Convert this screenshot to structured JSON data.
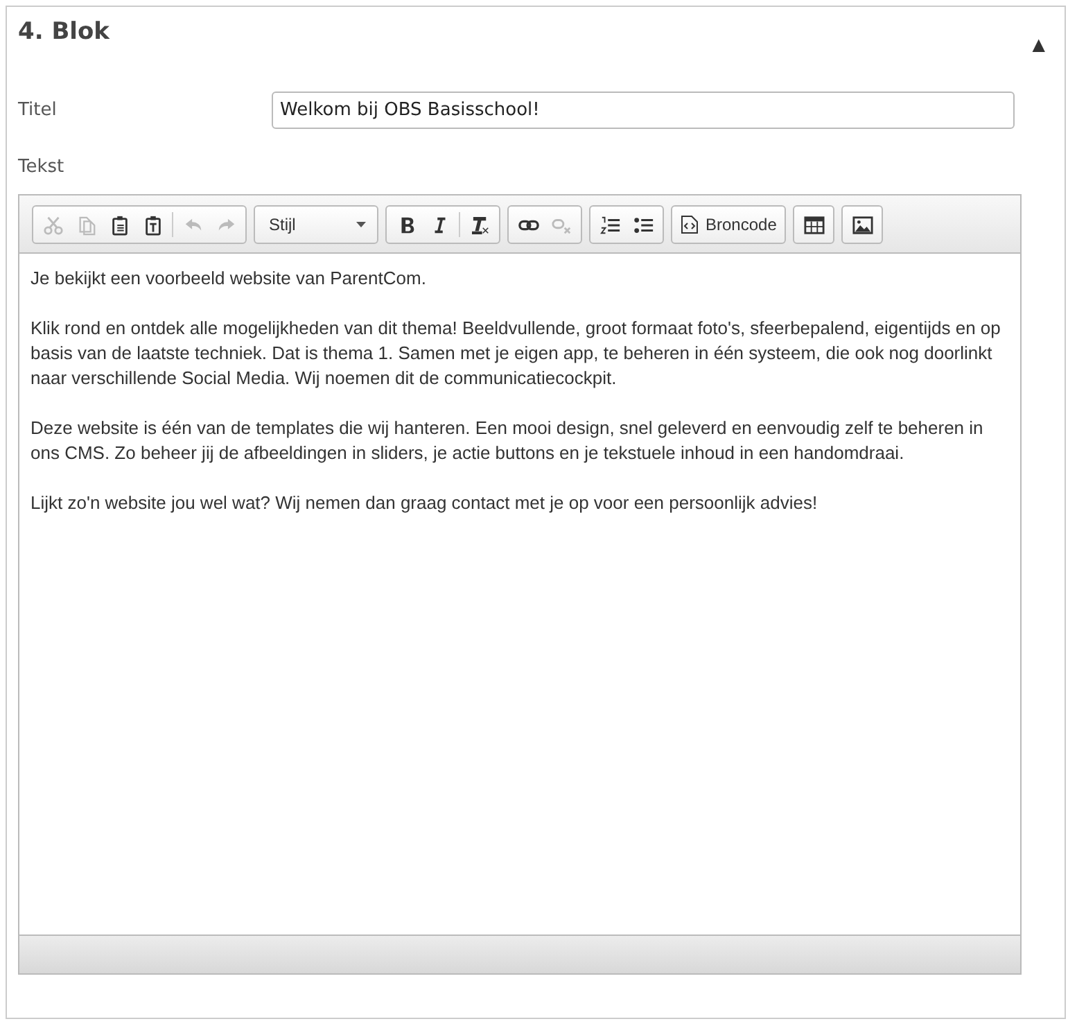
{
  "panel": {
    "title": "4. Blok",
    "collapse_glyph": "▲"
  },
  "fields": [
    {
      "label": "Titel",
      "value": "Welkom bij OBS Basisschool!"
    }
  ],
  "editor": {
    "label": "Tekst",
    "toolbar": [
      {
        "kind": "group",
        "buttons": [
          {
            "kind": "cut",
            "disabled": true
          },
          {
            "kind": "copy",
            "disabled": true
          },
          {
            "kind": "paste",
            "disabled": false
          },
          {
            "kind": "paste-text",
            "disabled": false
          },
          {
            "kind": "separator"
          },
          {
            "kind": "undo",
            "disabled": true
          },
          {
            "kind": "redo",
            "disabled": true
          }
        ]
      },
      {
        "kind": "dropdown",
        "label": "Stijl"
      },
      {
        "kind": "group",
        "buttons": [
          {
            "kind": "bold",
            "disabled": false
          },
          {
            "kind": "italic",
            "disabled": false
          },
          {
            "kind": "separator"
          },
          {
            "kind": "remove-format",
            "disabled": false
          }
        ]
      },
      {
        "kind": "group",
        "buttons": [
          {
            "kind": "link",
            "disabled": false
          },
          {
            "kind": "unlink",
            "disabled": true
          }
        ]
      },
      {
        "kind": "group",
        "buttons": [
          {
            "kind": "numbered-list",
            "disabled": false
          },
          {
            "kind": "bulleted-list",
            "disabled": false
          }
        ]
      },
      {
        "kind": "source",
        "label": "Broncode"
      },
      {
        "kind": "group",
        "buttons": [
          {
            "kind": "table",
            "disabled": false
          }
        ]
      },
      {
        "kind": "group",
        "buttons": [
          {
            "kind": "image",
            "disabled": false
          }
        ]
      }
    ],
    "paragraphs": [
      "Je bekijkt een voorbeeld website van ParentCom.",
      "Klik rond en ontdek alle mogelijkheden van dit thema! Beeldvullende, groot formaat foto's, sfeerbepalend, eigentijds en op basis van de laatste techniek. Dat is thema 1. Samen met je eigen app, te beheren in één systeem, die ook nog doorlinkt naar verschillende Social Media. Wij noemen dit de communicatiecockpit.",
      "Deze website is één van de templates die wij hanteren. Een mooi design, snel geleverd en eenvoudig zelf te beheren in ons CMS. Zo beheer jij de afbeeldingen in sliders, je actie buttons en je tekstuele inhoud in een handomdraai.",
      "Lijkt zo'n website jou wel wat? Wij nemen dan graag contact met je op voor een persoonlijk advies!"
    ]
  }
}
